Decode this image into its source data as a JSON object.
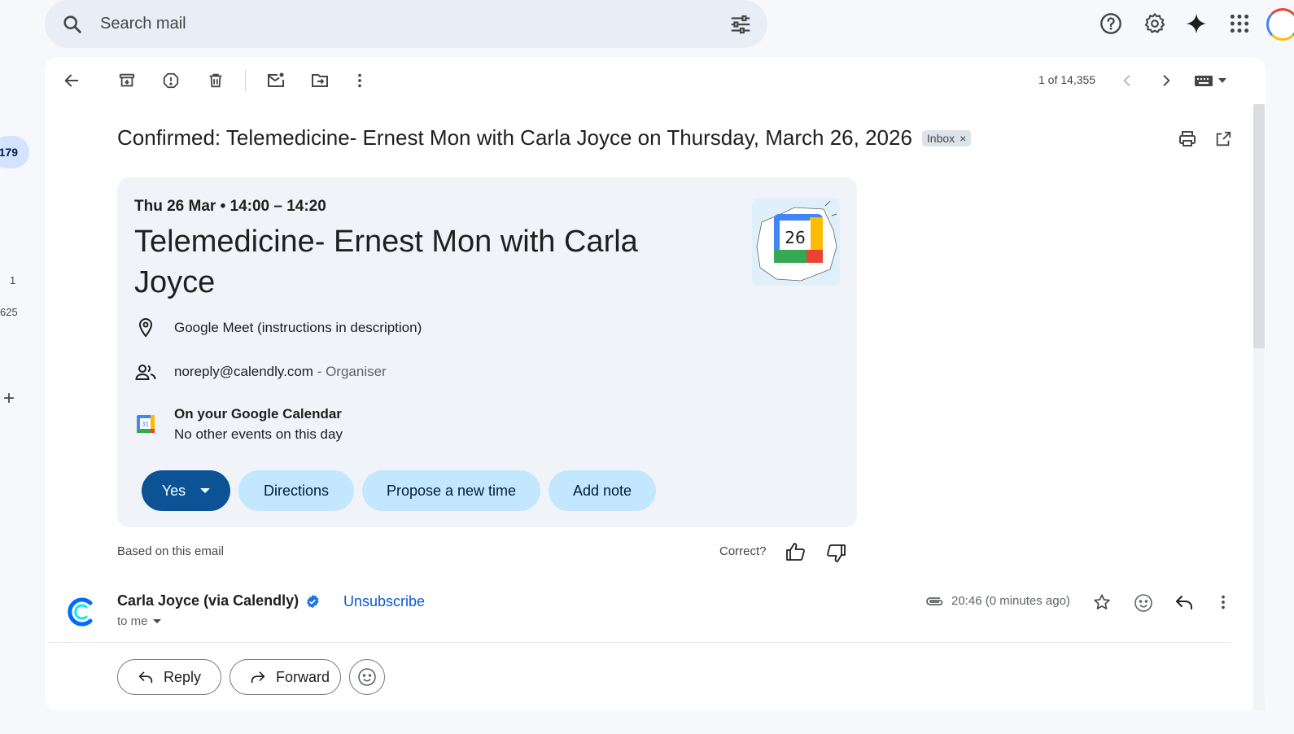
{
  "rail": {
    "badge": "179",
    "count_a": "1",
    "count_b": "625"
  },
  "search": {
    "placeholder": "Search mail"
  },
  "icons": {
    "search": "search-icon",
    "tune": "tune-icon",
    "help": "help-icon",
    "settings": "gear-icon",
    "gemini": "sparkle-icon",
    "apps": "apps-grid-icon"
  },
  "toolbar": {
    "pager": "1 of 14,355"
  },
  "message": {
    "subject": "Confirmed: Telemedicine- Ernest Mon with Carla Joyce on Thursday, March 26, 2026",
    "label": "Inbox",
    "label_close": "×"
  },
  "event": {
    "when": "Thu 26 Mar • 14:00 – 14:20",
    "title": "Telemedicine- Ernest Mon with Carla Joyce",
    "location": "Google Meet (instructions in description)",
    "organiser_email": "noreply@calendly.com",
    "organiser_role": " - Organiser",
    "calendar_heading": "On your Google Calendar",
    "calendar_sub": "No other events on this day",
    "illustration_day": "26",
    "calendar_icon_day": "31",
    "buttons": {
      "yes": "Yes",
      "directions": "Directions",
      "propose": "Propose a new time",
      "note": "Add note"
    }
  },
  "feedback": {
    "based_on": "Based on this email",
    "correct": "Correct?"
  },
  "sender": {
    "name": "Carla Joyce (via Calendly)",
    "unsubscribe": "Unsubscribe",
    "to": "to me",
    "time": "20:46 (0 minutes ago)"
  },
  "actions": {
    "reply": "Reply",
    "forward": "Forward"
  },
  "colors": {
    "accent": "#0b57d0",
    "yes_button": "#0b5394",
    "pill": "#c2e7ff",
    "card": "#f0f4f9",
    "calendly": "#006bff"
  }
}
